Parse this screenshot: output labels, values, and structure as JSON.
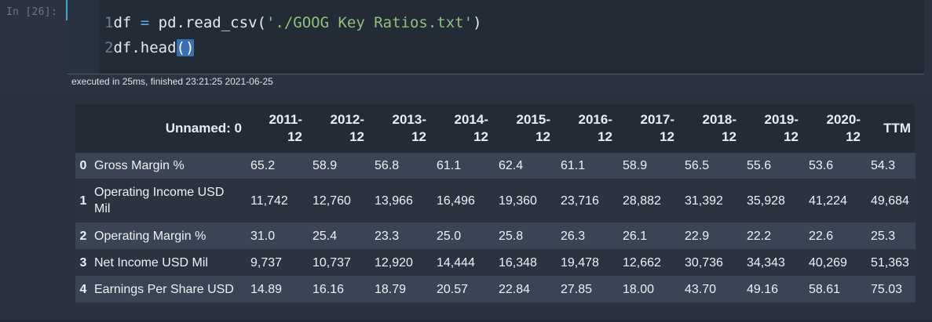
{
  "cell": {
    "prompt": "In [26]:",
    "code_lines": [
      {
        "ln": "1",
        "parts": [
          {
            "t": "df ",
            "c": ""
          },
          {
            "t": "=",
            "c": "op"
          },
          {
            "t": " pd.read_csv(",
            "c": ""
          },
          {
            "t": "'./GOOG Key Ratios.txt'",
            "c": "str"
          },
          {
            "t": ")",
            "c": ""
          }
        ]
      },
      {
        "ln": "2",
        "parts": [
          {
            "t": "df.head",
            "c": ""
          },
          {
            "t": "()",
            "c": "paren-hl"
          }
        ]
      }
    ],
    "exec_info": "executed in 25ms, finished 23:21:25 2021-06-25"
  },
  "table": {
    "columns": [
      "Unnamed: 0",
      "2011-\n12",
      "2012-\n12",
      "2013-\n12",
      "2014-\n12",
      "2015-\n12",
      "2016-\n12",
      "2017-\n12",
      "2018-\n12",
      "2019-\n12",
      "2020-\n12",
      "TTM"
    ],
    "rows": [
      {
        "index": "0",
        "label": "Gross Margin %",
        "values": [
          "65.2",
          "58.9",
          "56.8",
          "61.1",
          "62.4",
          "61.1",
          "58.9",
          "56.5",
          "55.6",
          "53.6",
          "54.3"
        ]
      },
      {
        "index": "1",
        "label": "Operating Income USD Mil",
        "values": [
          "11,742",
          "12,760",
          "13,966",
          "16,496",
          "19,360",
          "23,716",
          "28,882",
          "31,392",
          "35,928",
          "41,224",
          "49,684"
        ]
      },
      {
        "index": "2",
        "label": "Operating Margin %",
        "values": [
          "31.0",
          "25.4",
          "23.3",
          "25.0",
          "25.8",
          "26.3",
          "26.1",
          "22.9",
          "22.2",
          "22.6",
          "25.3"
        ]
      },
      {
        "index": "3",
        "label": "Net Income USD Mil",
        "values": [
          "9,737",
          "10,737",
          "12,920",
          "14,444",
          "16,348",
          "19,478",
          "12,662",
          "30,736",
          "34,343",
          "40,269",
          "51,363"
        ]
      },
      {
        "index": "4",
        "label": "Earnings Per Share USD",
        "values": [
          "14.89",
          "16.16",
          "18.79",
          "20.57",
          "22.84",
          "27.85",
          "18.00",
          "43.70",
          "49.16",
          "58.61",
          "75.03"
        ]
      }
    ]
  },
  "colors": {
    "background": "#2a3240",
    "editor": "#232b36",
    "header": "#232b36",
    "row_even": "#3a4454",
    "row_odd": "#2b3340",
    "string": "#8ec07c",
    "operator": "#5aa9e6",
    "bracket_highlight": "#3b6fb3",
    "active_marker": "#3fa7c8"
  }
}
